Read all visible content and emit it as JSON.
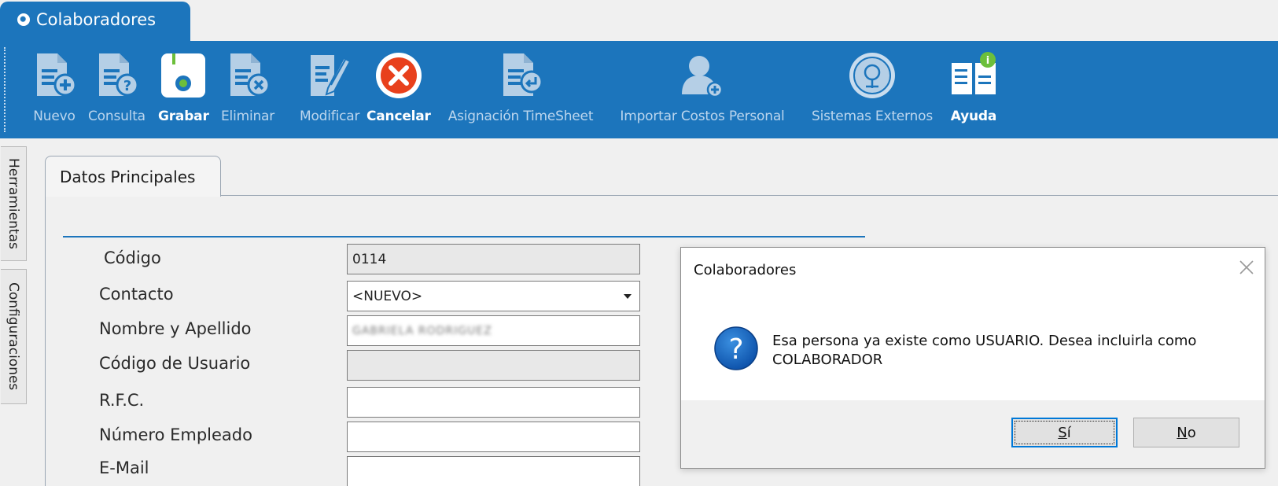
{
  "window": {
    "tab_title": "Colaboradores"
  },
  "toolbar": {
    "buttons": [
      {
        "label": "Nuevo",
        "icon": "doc-add-icon",
        "enabled": false
      },
      {
        "label": "Consulta",
        "icon": "doc-query-icon",
        "enabled": false
      },
      {
        "label": "Grabar",
        "icon": "save-icon",
        "enabled": true
      },
      {
        "label": "Eliminar",
        "icon": "doc-delete-icon",
        "enabled": false
      },
      {
        "label": "Modificar",
        "icon": "doc-edit-icon",
        "enabled": false
      },
      {
        "label": "Cancelar",
        "icon": "cancel-icon",
        "enabled": true
      },
      {
        "label": "Asignación TimeSheet",
        "icon": "doc-assign-icon",
        "enabled": false
      },
      {
        "label": "Importar Costos Personal",
        "icon": "user-add-icon",
        "enabled": false
      },
      {
        "label": "Sistemas Externos",
        "icon": "external-systems-icon",
        "enabled": false
      },
      {
        "label": "Ayuda",
        "icon": "help-book-icon",
        "enabled": true
      }
    ]
  },
  "side_tabs": [
    "Herramientas",
    "Configuraciones"
  ],
  "page_tab": "Datos Principales",
  "form": {
    "codigo_label": "Código",
    "codigo_value": "0114",
    "contacto_label": "Contacto",
    "contacto_value": "<NUEVO>",
    "nombre_label": "Nombre y Apellido",
    "nombre_value": "GABRIELA RODRIGUEZ",
    "codigo_usuario_label": "Código de Usuario",
    "codigo_usuario_value": "",
    "rfc_label": "R.F.C.",
    "rfc_value": "",
    "numero_empleado_label": "Número Empleado",
    "numero_empleado_value": "",
    "email_label": "E-Mail",
    "email_value": ""
  },
  "dialog": {
    "title": "Colaboradores",
    "message": "Esa persona ya existe como USUARIO. Desea incluirla como COLABORADOR",
    "yes_hotkey": "S",
    "yes_rest": "í",
    "no_hotkey": "N",
    "no_rest": "o"
  },
  "colors": {
    "ribbon_blue": "#1c75bc",
    "section_rule": "#1c75bc",
    "default_button_border": "#0078d7"
  }
}
